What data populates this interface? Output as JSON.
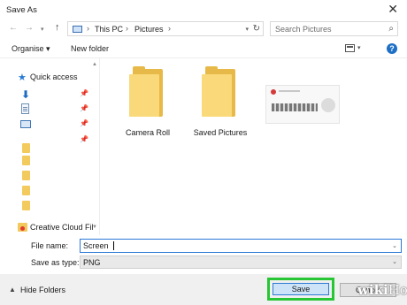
{
  "window": {
    "title": "Save As",
    "close_glyph": "✕"
  },
  "address": {
    "back_glyph": "←",
    "forward_glyph": "→",
    "recent_glyph": "▾",
    "up_glyph": "↑",
    "crumbs": [
      "This PC",
      "Pictures"
    ],
    "separator": "›",
    "dropdown_glyph": "▾",
    "refresh_glyph": "↻",
    "pc_icon": "computer-icon"
  },
  "search": {
    "placeholder": "Search Pictures",
    "icon_glyph": "⌕"
  },
  "toolbar": {
    "organise_label": "Organise ▾",
    "new_folder_label": "New folder",
    "view_dd_glyph": "▾",
    "help_glyph": "?"
  },
  "navigation": {
    "quick_access_label": "Quick access",
    "scroll_up_glyph": "▲",
    "scroll_down_glyph": "▼",
    "pin_glyph": "📌",
    "download_glyph": "⬇",
    "star_glyph": "★",
    "creative_cloud_label": "Creative Cloud Fil"
  },
  "files": {
    "items": [
      {
        "label": "Camera Roll",
        "icon": "folder-icon"
      },
      {
        "label": "Saved Pictures",
        "icon": "folder-icon"
      }
    ],
    "image_icon": "image-thumbnail"
  },
  "form": {
    "file_name_label": "File name:",
    "file_name_value": "Screen",
    "save_type_label": "Save as type:",
    "save_type_value": "PNG",
    "dropdown_glyph": "⌄"
  },
  "footer": {
    "hide_folders_glyph": "▲",
    "hide_folders_label": "Hide Folders",
    "save_label": "Save",
    "cancel_label": "Cancel",
    "highlight_color": "#27c635"
  },
  "watermark": {
    "wiki": "wiki",
    "how": "How"
  }
}
